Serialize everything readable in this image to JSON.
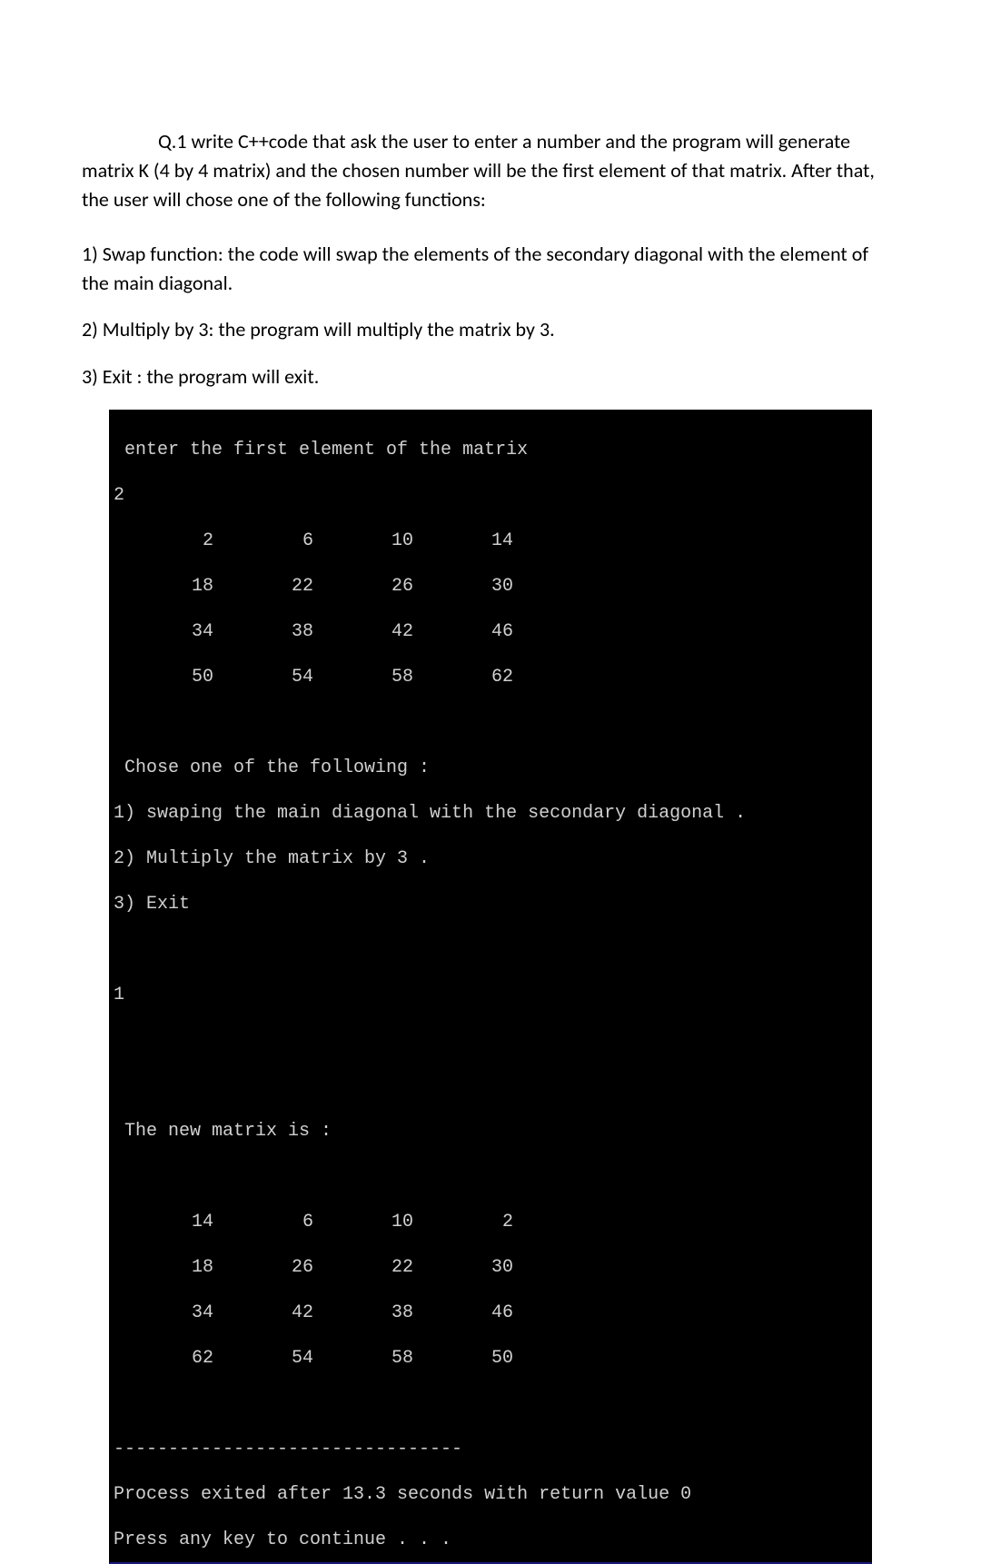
{
  "question": {
    "lead": "Q.1 write C++code that ask the user to enter a number and the program will generate matrix K (4 by 4 matrix) and the chosen number will be the first element of that matrix. After that, the user will chose one of the following functions:",
    "opt1": "1) Swap function: the code will swap the elements of the secondary diagonal with the element of the main diagonal.",
    "opt2": "2) Multiply by 3: the program will multiply the matrix by 3.",
    "opt3": "3) Exit : the program will exit."
  },
  "terminal": {
    "prompt1": " enter the first element of the matrix",
    "input1": "2",
    "matrix1": [
      [
        "2",
        "6",
        "10",
        "14"
      ],
      [
        "18",
        "22",
        "26",
        "30"
      ],
      [
        "34",
        "38",
        "42",
        "46"
      ],
      [
        "50",
        "54",
        "58",
        "62"
      ]
    ],
    "menu_header": " Chose one of the following :",
    "menu1": "1) swaping the main diagonal with the secondary diagonal .",
    "menu2": "2) Multiply the matrix by 3 .",
    "menu3": "3) Exit",
    "input2": "1",
    "result_header": " The new matrix is :",
    "matrix2": [
      [
        "14",
        "6",
        "10",
        "2"
      ],
      [
        "18",
        "26",
        "22",
        "30"
      ],
      [
        "34",
        "42",
        "38",
        "46"
      ],
      [
        "62",
        "54",
        "58",
        "50"
      ]
    ],
    "divider": "--------------------------------",
    "exit_line": "Process exited after 13.3 seconds with return value 0",
    "press_key": "Press any key to continue . . ."
  }
}
